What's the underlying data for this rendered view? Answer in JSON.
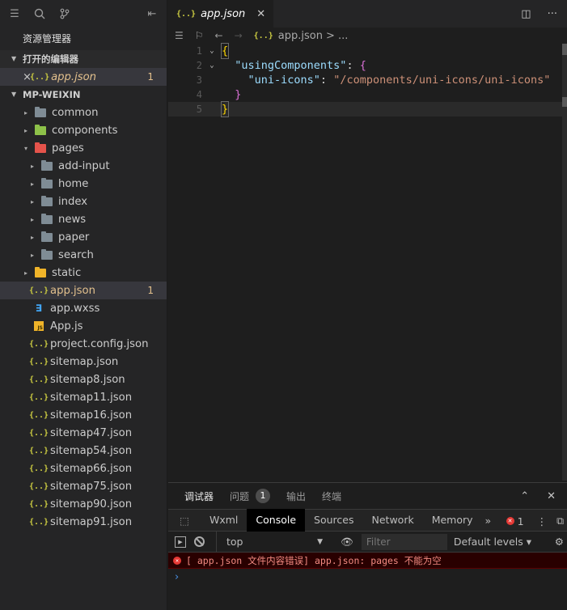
{
  "sidebar": {
    "title": "资源管理器",
    "open_editors_label": "打开的编辑器",
    "open_editors": [
      {
        "close": "×",
        "label": "app.json",
        "badge": "1"
      }
    ],
    "workspace_label": "MP-WEIXIN",
    "tree": [
      {
        "label": "common",
        "type": "folder",
        "icon": "folder",
        "twisty": "▸"
      },
      {
        "label": "components",
        "type": "folder",
        "icon": "folder-green",
        "twisty": "▸"
      },
      {
        "label": "pages",
        "type": "folder",
        "icon": "folder-red",
        "twisty": "▾"
      },
      {
        "label": "add-input",
        "type": "folder",
        "icon": "folder",
        "twisty": "▸"
      },
      {
        "label": "home",
        "type": "folder",
        "icon": "folder",
        "twisty": "▸"
      },
      {
        "label": "index",
        "type": "folder",
        "icon": "folder",
        "twisty": "▸"
      },
      {
        "label": "news",
        "type": "folder",
        "icon": "folder",
        "twisty": "▸"
      },
      {
        "label": "paper",
        "type": "folder",
        "icon": "folder",
        "twisty": "▸"
      },
      {
        "label": "search",
        "type": "folder",
        "icon": "folder",
        "twisty": "▸"
      },
      {
        "label": "static",
        "type": "folder",
        "icon": "folder-yellow",
        "twisty": "▸"
      },
      {
        "label": "app.json",
        "type": "file",
        "icon": "json",
        "badge": "1"
      },
      {
        "label": "app.wxss",
        "type": "file",
        "icon": "css"
      },
      {
        "label": "App.js",
        "type": "file",
        "icon": "js"
      },
      {
        "label": "project.config.json",
        "type": "file",
        "icon": "json"
      },
      {
        "label": "sitemap.json",
        "type": "file",
        "icon": "json"
      },
      {
        "label": "sitemap8.json",
        "type": "file",
        "icon": "json"
      },
      {
        "label": "sitemap11.json",
        "type": "file",
        "icon": "json"
      },
      {
        "label": "sitemap16.json",
        "type": "file",
        "icon": "json"
      },
      {
        "label": "sitemap47.json",
        "type": "file",
        "icon": "json"
      },
      {
        "label": "sitemap54.json",
        "type": "file",
        "icon": "json"
      },
      {
        "label": "sitemap66.json",
        "type": "file",
        "icon": "json"
      },
      {
        "label": "sitemap75.json",
        "type": "file",
        "icon": "json"
      },
      {
        "label": "sitemap90.json",
        "type": "file",
        "icon": "json"
      },
      {
        "label": "sitemap91.json",
        "type": "file",
        "icon": "json"
      }
    ]
  },
  "editor": {
    "tab": {
      "icon_text": "{..}",
      "label": "app.json",
      "close": "✕"
    },
    "breadcrumb": {
      "icon_text": "{..}",
      "file": "app.json",
      "rest": "> ..."
    },
    "code": {
      "line_numbers": [
        "1",
        "2",
        "3",
        "4",
        "5"
      ],
      "l1": "{",
      "l2_key": "\"usingComponents\"",
      "l2_colon": ": ",
      "l2_brace": "{",
      "l3_key": "\"uni-icons\"",
      "l3_colon": ": ",
      "l3_val": "\"/components/uni-icons/uni-icons\"",
      "l4": "}",
      "l5": "}"
    }
  },
  "panel": {
    "tabs": [
      {
        "label": "调试器"
      },
      {
        "label": "问题",
        "badge": "1"
      },
      {
        "label": "输出"
      },
      {
        "label": "终端"
      }
    ],
    "devtools_tabs": [
      "Wxml",
      "Console",
      "Sources",
      "Network",
      "Memory"
    ],
    "more": "»",
    "error_count": "1",
    "context": "top",
    "filter_placeholder": "Filter",
    "levels": "Default levels ▾",
    "error_message": "[ app.json 文件内容错误] app.json: pages 不能为空",
    "prompt": "›"
  },
  "icons": {
    "explorer": "files-icon",
    "search": "search-icon",
    "scm": "source-control-icon",
    "collapse": "collapse-icon"
  }
}
